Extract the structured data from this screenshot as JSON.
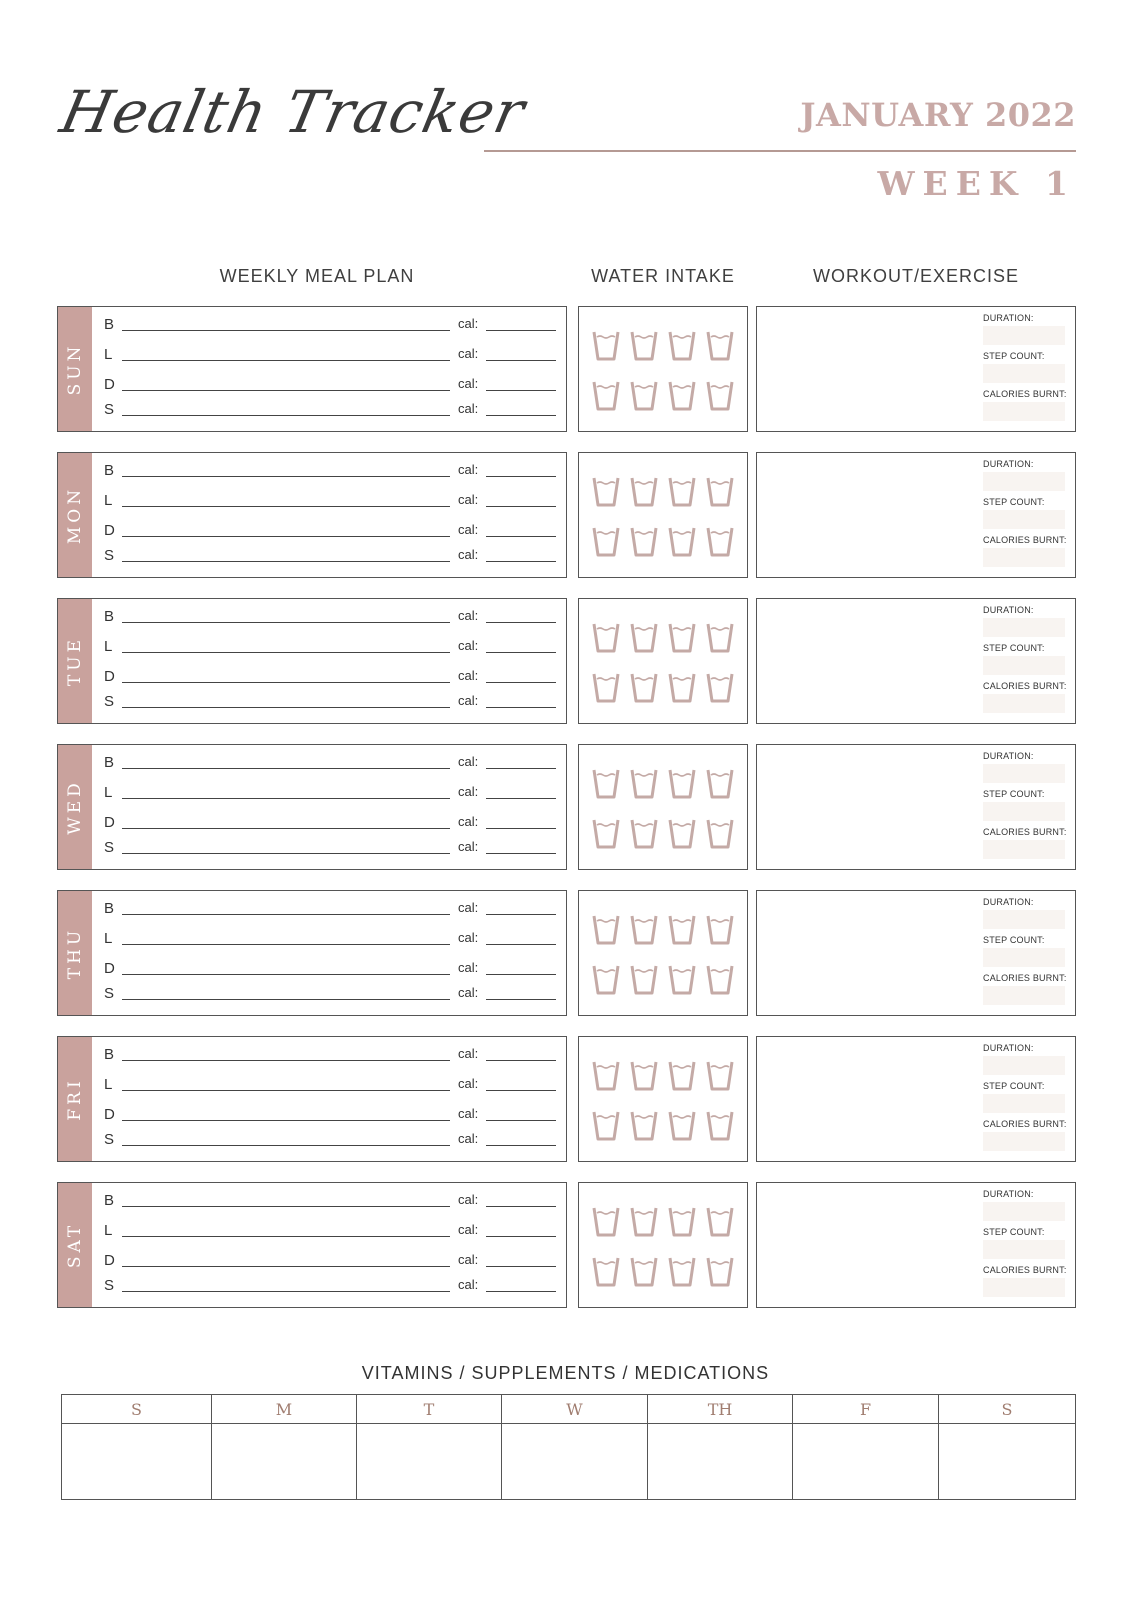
{
  "header": {
    "title": "Health Tracker",
    "month": "JANUARY 2022",
    "week": "WEEK 1"
  },
  "columns": {
    "meal_plan": "WEEKLY MEAL PLAN",
    "water": "WATER INTAKE",
    "workout": "WORKOUT/EXERCISE"
  },
  "meal_letters": [
    "B",
    "L",
    "D",
    "S"
  ],
  "cal_label": "cal:",
  "workout_fields": [
    "DURATION:",
    "STEP COUNT:",
    "CALORIES BURNT:"
  ],
  "water_cups_per_day": 8,
  "days": [
    {
      "label": "SUN"
    },
    {
      "label": "MON"
    },
    {
      "label": "TUE"
    },
    {
      "label": "WED"
    },
    {
      "label": "THU"
    },
    {
      "label": "FRI"
    },
    {
      "label": "SAT"
    }
  ],
  "vitamins": {
    "title": "VITAMINS / SUPPLEMENTS / MEDICATIONS",
    "days": [
      "S",
      "M",
      "T",
      "W",
      "TH",
      "F",
      "S"
    ]
  },
  "colors": {
    "accent": "#c9a29d",
    "heading_accent": "#c8a9a6",
    "cup": "#c4aaa6",
    "field_fill": "#f8f4f1"
  }
}
